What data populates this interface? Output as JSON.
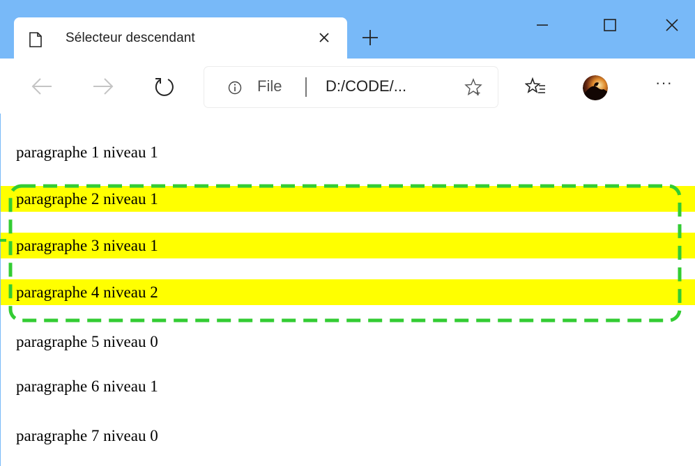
{
  "tab": {
    "title": "Sélecteur descendant"
  },
  "address_bar": {
    "scheme_label": "File",
    "url": "D:/CODE/..."
  },
  "window_controls": {
    "more_label": "···"
  },
  "page": {
    "paragraphs": [
      {
        "text": "paragraphe 1 niveau 1",
        "highlighted": false
      },
      {
        "text": "paragraphe 2 niveau 1",
        "highlighted": true
      },
      {
        "text": "paragraphe 3 niveau 1",
        "highlighted": true
      },
      {
        "text": "paragraphe 4 niveau 2",
        "highlighted": true
      },
      {
        "text": "paragraphe 5 niveau 0",
        "highlighted": false
      },
      {
        "text": "paragraphe 6 niveau 1",
        "highlighted": false
      },
      {
        "text": "paragraphe 7 niveau 0",
        "highlighted": false
      }
    ]
  },
  "colors": {
    "tabbar": "#78b9f8",
    "highlight": "#ffff00",
    "annotation_border": "#33cc33"
  },
  "icons": [
    "page-icon",
    "close-icon",
    "plus-icon",
    "minimize-icon",
    "maximize-icon",
    "close-window-icon",
    "back-arrow-icon",
    "forward-arrow-icon",
    "refresh-icon",
    "info-icon",
    "star-add-icon",
    "favorites-icon",
    "avatar",
    "more-icon"
  ]
}
